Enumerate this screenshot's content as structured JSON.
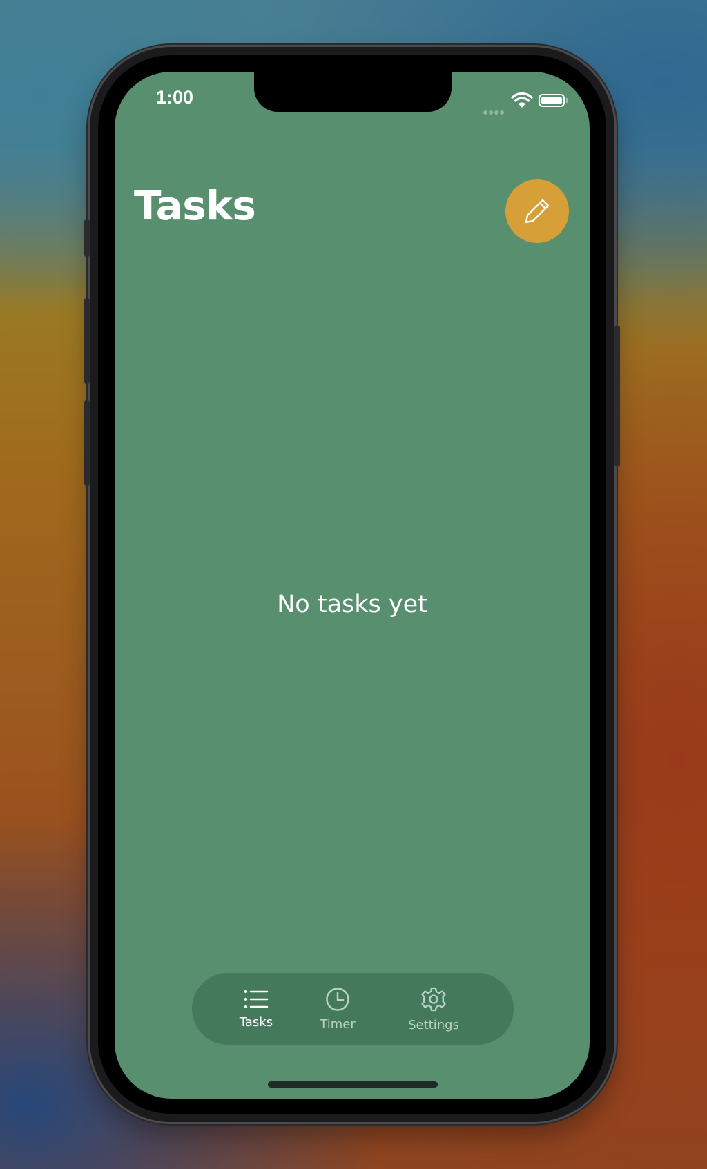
{
  "status_bar": {
    "time": "1:00"
  },
  "header": {
    "title": "Tasks",
    "compose_icon": "pencil-icon"
  },
  "main": {
    "empty_message": "No tasks yet"
  },
  "tab_bar": {
    "tabs": [
      {
        "label": "Tasks",
        "icon": "list-icon",
        "active": true
      },
      {
        "label": "Timer",
        "icon": "clock-icon",
        "active": false
      },
      {
        "label": "Settings",
        "icon": "gear-icon",
        "active": false
      }
    ]
  },
  "colors": {
    "screen_background": "#578f6f",
    "tab_bar_background": "#447a5b",
    "fab_accent": "#d69f38",
    "text": "#ffffff",
    "inactive_tab_text": "#b9d2c3"
  }
}
